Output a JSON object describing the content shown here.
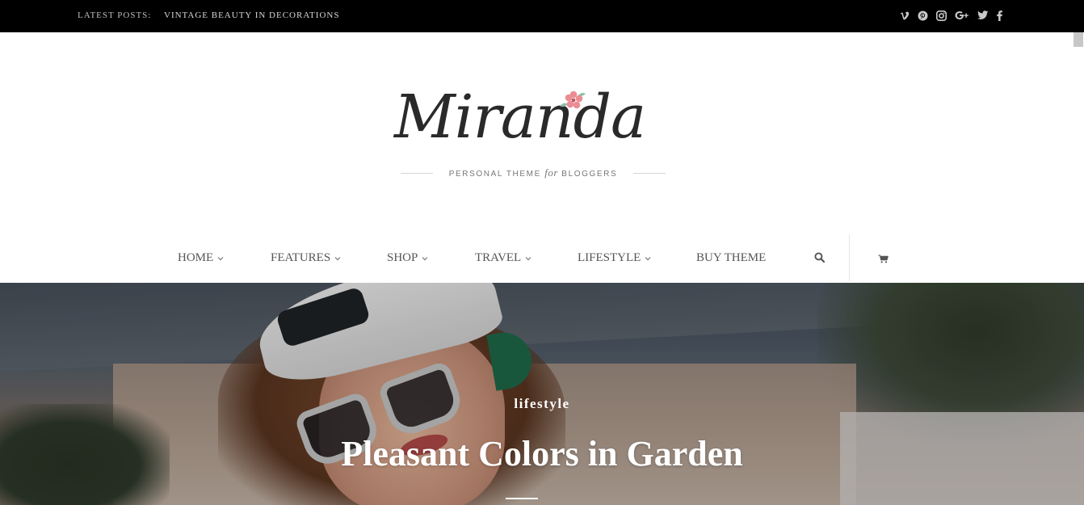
{
  "topbar": {
    "latest_label": "LATEST POSTS:",
    "latest_post": "VINTAGE BEAUTY IN DECORATIONS",
    "social_icons": [
      "vimeo-icon",
      "pinterest-icon",
      "instagram-icon",
      "google-plus-icon",
      "twitter-icon",
      "facebook-icon"
    ]
  },
  "header": {
    "logo_text": "Miranda",
    "tagline_before": "PERSONAL THEME",
    "tagline_for": "for",
    "tagline_after": "BLOGGERS"
  },
  "nav": {
    "items": [
      {
        "label": "HOME",
        "has_dropdown": true
      },
      {
        "label": "FEATURES",
        "has_dropdown": true
      },
      {
        "label": "SHOP",
        "has_dropdown": true
      },
      {
        "label": "TRAVEL",
        "has_dropdown": true
      },
      {
        "label": "LIFESTYLE",
        "has_dropdown": true
      },
      {
        "label": "BUY THEME",
        "has_dropdown": false
      }
    ],
    "icons": [
      "search-icon",
      "cart-icon"
    ]
  },
  "hero": {
    "category": "lifestyle",
    "title": "Pleasant Colors in Garden"
  },
  "colors": {
    "topbar_bg": "#000000",
    "logo_text": "#2a2a2a",
    "flower": "#e8858a",
    "nav_text": "#555555",
    "hero_text": "#ffffff"
  }
}
